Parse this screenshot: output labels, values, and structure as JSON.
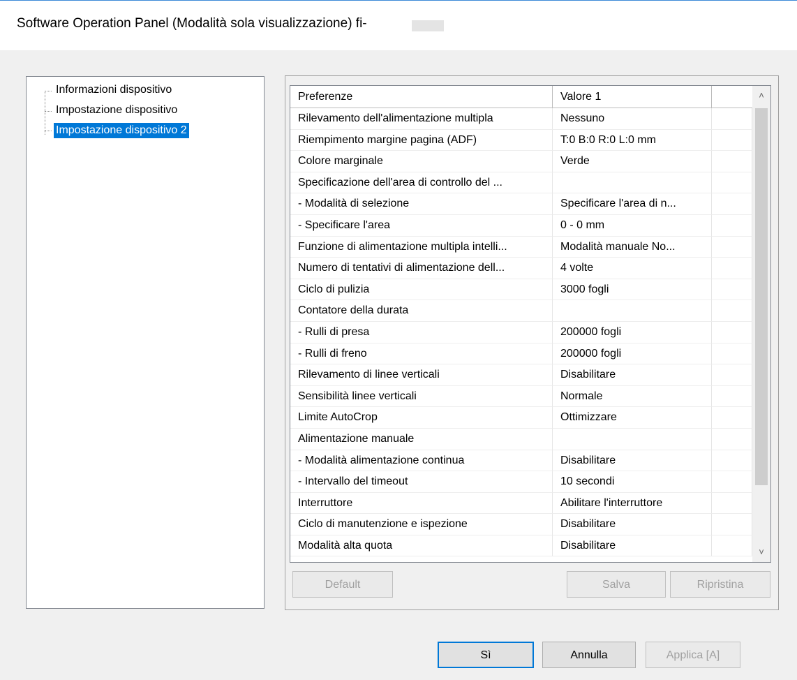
{
  "window": {
    "title": "Software Operation Panel (Modalità sola visualizzazione) fi-"
  },
  "tree": {
    "items": [
      {
        "label": "Informazioni dispositivo",
        "selected": false
      },
      {
        "label": "Impostazione dispositivo",
        "selected": false
      },
      {
        "label": "Impostazione dispositivo 2",
        "selected": true
      }
    ]
  },
  "grid": {
    "headers": [
      "Preferenze",
      "Valore 1",
      ""
    ],
    "rows": [
      [
        "Rilevamento dell'alimentazione multipla",
        "Nessuno"
      ],
      [
        "Riempimento margine pagina (ADF)",
        "T:0  B:0  R:0  L:0 mm"
      ],
      [
        "Colore marginale",
        "Verde"
      ],
      [
        "Specificazione dell'area di controllo del ...",
        ""
      ],
      [
        " - Modalità di selezione",
        "Specificare l'area di n..."
      ],
      [
        " - Specificare l'area",
        "0 - 0 mm"
      ],
      [
        "Funzione di alimentazione multipla intelli...",
        "Modalità manuale  No..."
      ],
      [
        "Numero di tentativi di alimentazione dell...",
        "4 volte"
      ],
      [
        "Ciclo di pulizia",
        "3000 fogli"
      ],
      [
        "Contatore della durata",
        ""
      ],
      [
        " - Rulli di presa",
        "200000 fogli"
      ],
      [
        " - Rulli di freno",
        "200000 fogli"
      ],
      [
        "Rilevamento di linee verticali",
        "Disabilitare"
      ],
      [
        "Sensibilità linee verticali",
        "Normale"
      ],
      [
        "Limite AutoCrop",
        "Ottimizzare"
      ],
      [
        "Alimentazione manuale",
        ""
      ],
      [
        " - Modalità alimentazione continua",
        "Disabilitare"
      ],
      [
        " - Intervallo del timeout",
        "10 secondi"
      ],
      [
        "Interruttore",
        "Abilitare l'interruttore"
      ],
      [
        "Ciclo di manutenzione e ispezione",
        "Disabilitare"
      ],
      [
        "Modalità alta quota",
        "Disabilitare"
      ]
    ]
  },
  "scrollbar": {
    "up_glyph": "˄",
    "down_glyph": "˅"
  },
  "panel_buttons": {
    "default": "Default",
    "save": "Salva",
    "restore": "Ripristina"
  },
  "dialog_buttons": {
    "ok": "Sì",
    "cancel": "Annulla",
    "apply": "Applica [A]"
  },
  "colors": {
    "selection": "#0078d7",
    "window_bg": "#f0f0f0",
    "title_border": "#3c8ad8"
  }
}
